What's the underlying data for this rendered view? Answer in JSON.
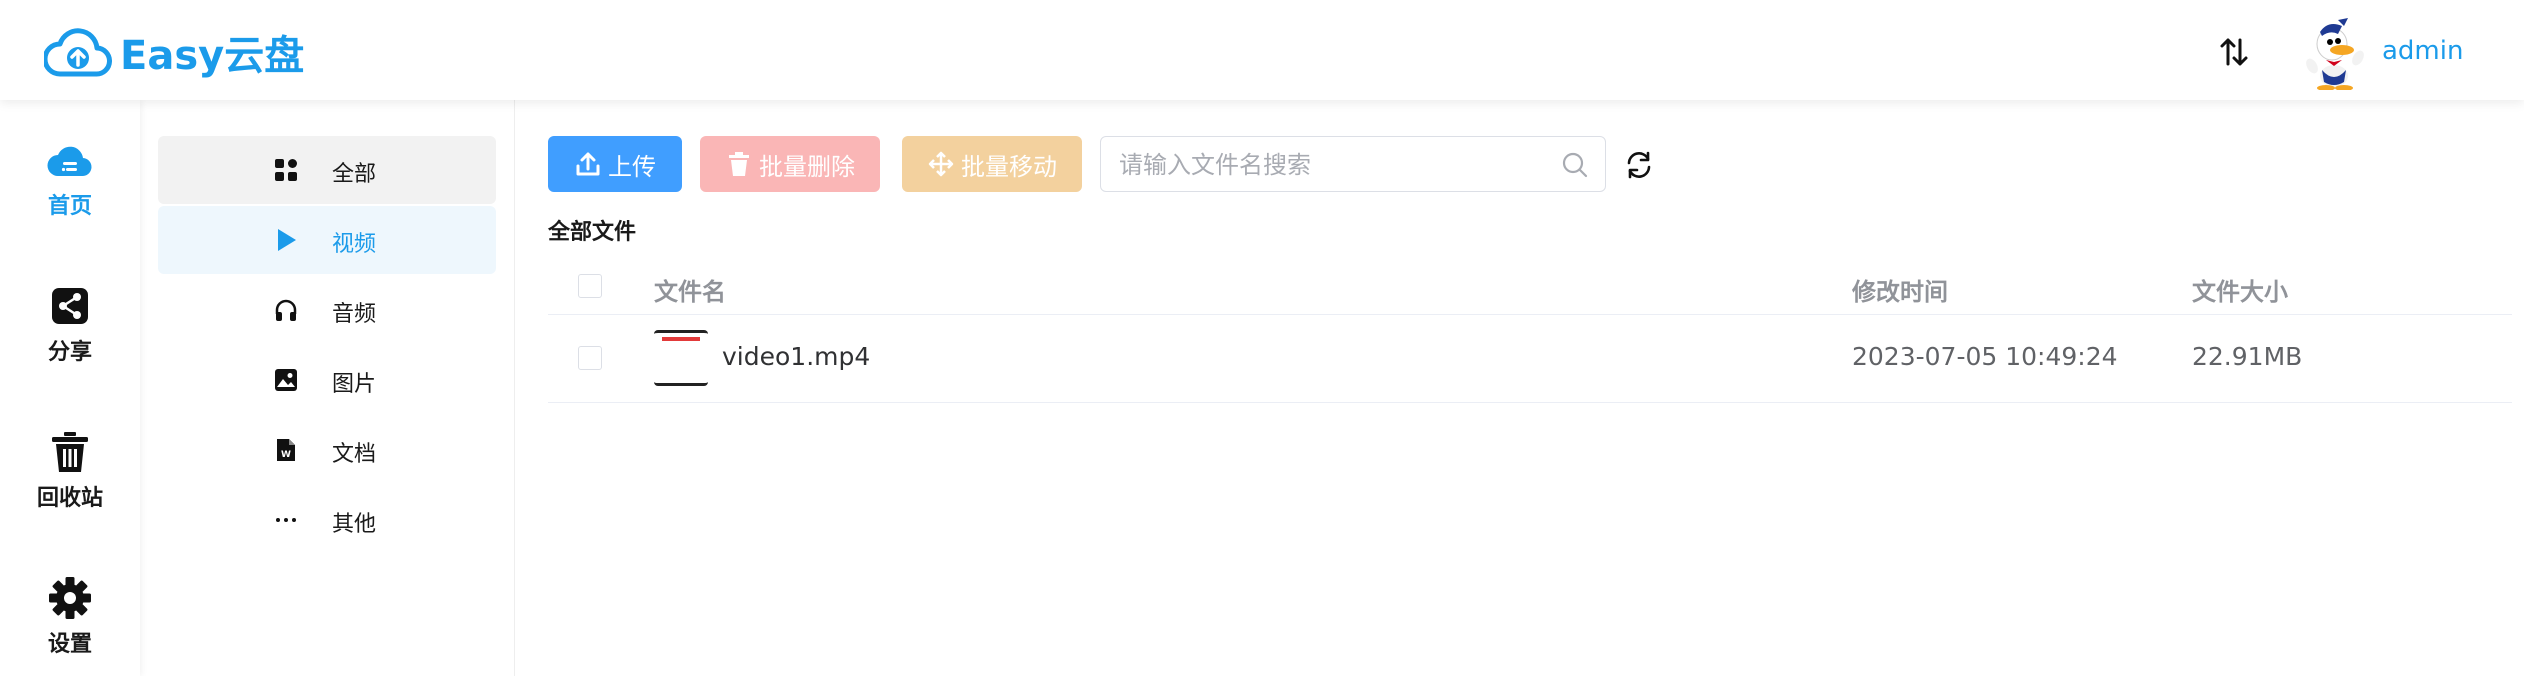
{
  "app": {
    "name": "Easy云盘",
    "brand_color": "#1b9bea"
  },
  "header": {
    "transfer_icon": "sort-arrows-icon",
    "user_name": "admin"
  },
  "rail": {
    "items": [
      {
        "label": "首页",
        "icon": "cloud-home-icon",
        "active": true
      },
      {
        "label": "分享",
        "icon": "share-icon",
        "active": false
      },
      {
        "label": "回收站",
        "icon": "trash-icon",
        "active": false
      },
      {
        "label": "设置",
        "icon": "gear-icon",
        "active": false
      }
    ]
  },
  "submenu": {
    "items": [
      {
        "label": "全部",
        "icon": "grid-icon"
      },
      {
        "label": "视频",
        "icon": "play-icon"
      },
      {
        "label": "音频",
        "icon": "headphones-icon"
      },
      {
        "label": "图片",
        "icon": "image-icon"
      },
      {
        "label": "文档",
        "icon": "word-doc-icon"
      },
      {
        "label": "其他",
        "icon": "more-dots-icon"
      }
    ],
    "active_index": 1
  },
  "toolbar": {
    "upload_label": "上传",
    "batch_delete_label": "批量删除",
    "batch_move_label": "批量移动",
    "search_placeholder": "请输入文件名搜索"
  },
  "breadcrumb": "全部文件",
  "table": {
    "columns": [
      "文件名",
      "修改时间",
      "文件大小"
    ],
    "rows": [
      {
        "name": "video1.mp4",
        "modified": "2023-07-05 10:49:24",
        "size": "22.91MB"
      }
    ]
  },
  "colors": {
    "upload": "#409eff",
    "delete": "#fab6b6",
    "move": "#f3d19e"
  }
}
